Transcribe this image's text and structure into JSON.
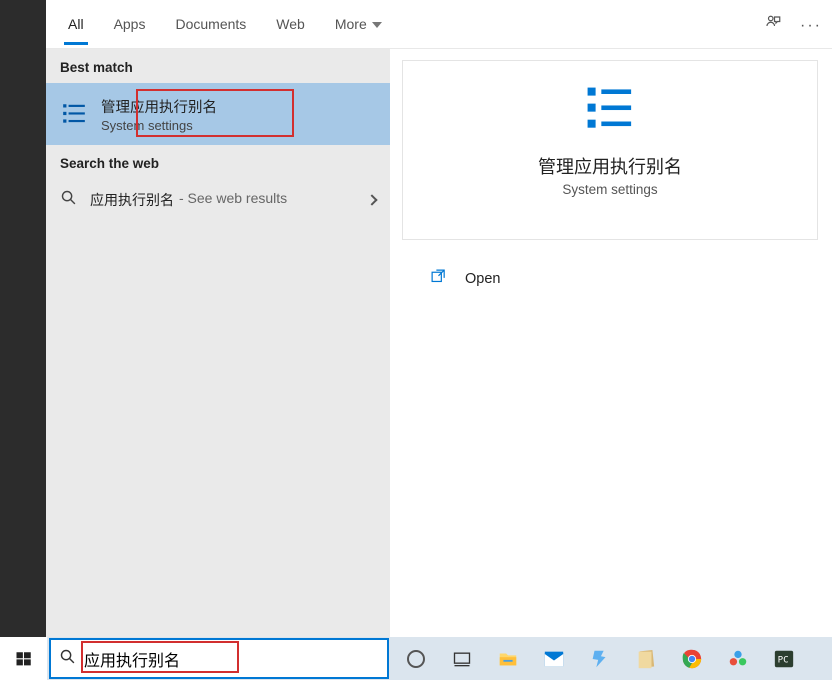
{
  "tabs": {
    "all": "All",
    "apps": "Apps",
    "documents": "Documents",
    "web": "Web",
    "more": "More"
  },
  "sections": {
    "best_match": "Best match",
    "search_web": "Search the web"
  },
  "results": {
    "best": {
      "title": "管理应用执行别名",
      "subtitle": "System settings"
    },
    "web": {
      "query": "应用执行别名",
      "suffix": "- See web results"
    }
  },
  "preview": {
    "title": "管理应用执行别名",
    "subtitle": "System settings",
    "open": "Open"
  },
  "searchbox": {
    "value": "应用执行别名"
  },
  "taskbar": {
    "icons": [
      "cortana-icon",
      "taskview-icon",
      "file-explorer-icon",
      "mail-icon",
      "thunder-icon",
      "notes-icon",
      "chrome-icon",
      "app-icon",
      "terminal-icon"
    ]
  }
}
